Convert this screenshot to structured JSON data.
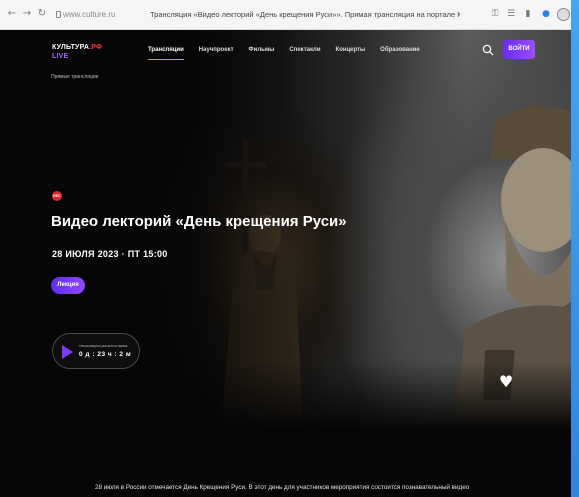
{
  "browser": {
    "address": "www.culture.ru",
    "tab_title": "Трансляция «Видео лекторий «День крещения Руси»». Прямая трансляция на портале Культура.РФ",
    "accent": "#2d7fe0"
  },
  "header": {
    "logo_main": "КУЛЬТУРА",
    "logo_suffix": ".РФ",
    "logo_live": "LIVE",
    "nav": [
      {
        "label": "Трансляции",
        "active": true
      },
      {
        "label": "Научпроект",
        "active": false
      },
      {
        "label": "Фильмы",
        "active": false
      },
      {
        "label": "Спектакли",
        "active": false
      },
      {
        "label": "Концерты",
        "active": false
      },
      {
        "label": "Образование",
        "active": false
      }
    ],
    "login_label": "ВОЙТИ",
    "accent": "#8a3ffc"
  },
  "breadcrumb": "Прямые трансляции",
  "event": {
    "rec_badge": "REC",
    "title": "Видео лекторий «День крещения Руси»",
    "date": "28 ИЮЛЯ 2023 · ПТ 15:00",
    "tag": "Лекция",
    "countdown_label": "ТРАНСЛЯЦИЯ НАЧНЕТСЯ ЧЕРЕЗ:",
    "countdown_value": "0 д : 23 ч : 2 м"
  },
  "description": "28 июля в России отмечается День Крещения Руси. В этот день для участников мероприятия состоится познавательный видео"
}
